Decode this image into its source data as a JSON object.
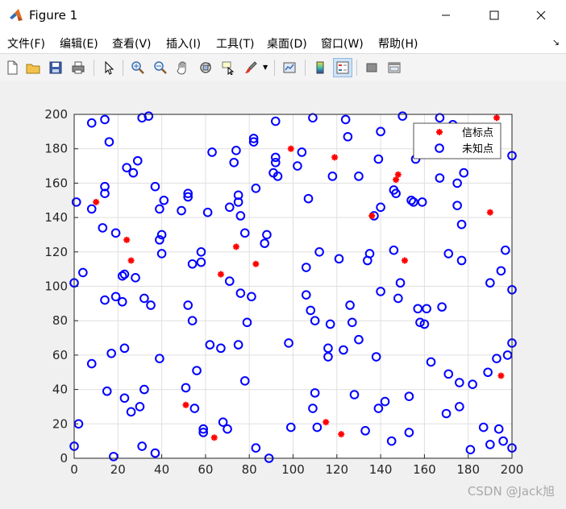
{
  "window": {
    "title": "Figure 1"
  },
  "menu": [
    "文件(F)",
    "编辑(E)",
    "查看(V)",
    "插入(I)",
    "工具(T)",
    "桌面(D)",
    "窗口(W)",
    "帮助(H)"
  ],
  "toolbar": {
    "icons": [
      "new-file-icon",
      "open-file-icon",
      "save-icon",
      "print-icon",
      "pointer-icon",
      "zoom-in-icon",
      "zoom-out-icon",
      "pan-icon",
      "rotate-3d-icon",
      "data-cursor-icon",
      "brush-icon",
      "link-plot-icon",
      "colorbar-icon",
      "legend-icon",
      "hide-plot-tools-icon",
      "show-plot-tools-icon"
    ],
    "active": "legend-icon"
  },
  "chart_data": {
    "type": "scatter",
    "xlim": [
      0,
      200
    ],
    "ylim": [
      0,
      200
    ],
    "xticks": [
      0,
      20,
      40,
      60,
      80,
      100,
      120,
      140,
      160,
      180,
      200
    ],
    "yticks": [
      0,
      20,
      40,
      60,
      80,
      100,
      120,
      140,
      160,
      180,
      200
    ],
    "grid": true,
    "legend_position": "top-right",
    "series": [
      {
        "name": "信标点",
        "marker": "asterisk",
        "color": "#ff0000",
        "points": [
          [
            10,
            149
          ],
          [
            24,
            127
          ],
          [
            26,
            115
          ],
          [
            51,
            31
          ],
          [
            64,
            12
          ],
          [
            67,
            107
          ],
          [
            74,
            123
          ],
          [
            83,
            113
          ],
          [
            99,
            180
          ],
          [
            115,
            21
          ],
          [
            119,
            175
          ],
          [
            122,
            14
          ],
          [
            136,
            141
          ],
          [
            147,
            162
          ],
          [
            148,
            165
          ],
          [
            151,
            115
          ],
          [
            190,
            143
          ],
          [
            193,
            198
          ],
          [
            195,
            48
          ]
        ]
      },
      {
        "name": "未知点",
        "marker": "circle",
        "color": "#0000ff",
        "points": [
          [
            0,
            7
          ],
          [
            1,
            149
          ],
          [
            0,
            102
          ],
          [
            2,
            20
          ],
          [
            4,
            108
          ],
          [
            8,
            145
          ],
          [
            8,
            195
          ],
          [
            8,
            55
          ],
          [
            13,
            134
          ],
          [
            14,
            158
          ],
          [
            14,
            154
          ],
          [
            14,
            197
          ],
          [
            14,
            92
          ],
          [
            15,
            39
          ],
          [
            16,
            184
          ],
          [
            17,
            61
          ],
          [
            18,
            1
          ],
          [
            19,
            131
          ],
          [
            19,
            94
          ],
          [
            22,
            106
          ],
          [
            23,
            107
          ],
          [
            22,
            91
          ],
          [
            23,
            64
          ],
          [
            23,
            35
          ],
          [
            24,
            169
          ],
          [
            26,
            27
          ],
          [
            27,
            166
          ],
          [
            28,
            105
          ],
          [
            29,
            173
          ],
          [
            30,
            30
          ],
          [
            31,
            7
          ],
          [
            31,
            198
          ],
          [
            32,
            93
          ],
          [
            32,
            40
          ],
          [
            34,
            199
          ],
          [
            35,
            89
          ],
          [
            37,
            158
          ],
          [
            37,
            3
          ],
          [
            39,
            127
          ],
          [
            39,
            145
          ],
          [
            40,
            130
          ],
          [
            39,
            58
          ],
          [
            40,
            119
          ],
          [
            41,
            150
          ],
          [
            49,
            144
          ],
          [
            51,
            41
          ],
          [
            52,
            154
          ],
          [
            52,
            152
          ],
          [
            52,
            89
          ],
          [
            54,
            113
          ],
          [
            54,
            80
          ],
          [
            55,
            29
          ],
          [
            56,
            51
          ],
          [
            58,
            114
          ],
          [
            58,
            120
          ],
          [
            59,
            17
          ],
          [
            59,
            15
          ],
          [
            61,
            143
          ],
          [
            62,
            66
          ],
          [
            63,
            178
          ],
          [
            67,
            64
          ],
          [
            68,
            21
          ],
          [
            70,
            17
          ],
          [
            71,
            103
          ],
          [
            71,
            146
          ],
          [
            73,
            172
          ],
          [
            74,
            179
          ],
          [
            75,
            149
          ],
          [
            75,
            153
          ],
          [
            75,
            66
          ],
          [
            76,
            141
          ],
          [
            76,
            96
          ],
          [
            78,
            131
          ],
          [
            78,
            45
          ],
          [
            79,
            79
          ],
          [
            81,
            94
          ],
          [
            82,
            186
          ],
          [
            82,
            184
          ],
          [
            83,
            157
          ],
          [
            83,
            6
          ],
          [
            87,
            125
          ],
          [
            88,
            130
          ],
          [
            89,
            0
          ],
          [
            91,
            166
          ],
          [
            92,
            172
          ],
          [
            92,
            175
          ],
          [
            92,
            196
          ],
          [
            93,
            164
          ],
          [
            98,
            67
          ],
          [
            99,
            18
          ],
          [
            102,
            170
          ],
          [
            104,
            178
          ],
          [
            106,
            95
          ],
          [
            106,
            111
          ],
          [
            107,
            151
          ],
          [
            108,
            86
          ],
          [
            109,
            198
          ],
          [
            109,
            29
          ],
          [
            110,
            80
          ],
          [
            110,
            38
          ],
          [
            111,
            18
          ],
          [
            112,
            120
          ],
          [
            116,
            64
          ],
          [
            116,
            59
          ],
          [
            117,
            78
          ],
          [
            118,
            164
          ],
          [
            121,
            116
          ],
          [
            123,
            63
          ],
          [
            124,
            197
          ],
          [
            125,
            187
          ],
          [
            126,
            89
          ],
          [
            127,
            79
          ],
          [
            128,
            37
          ],
          [
            130,
            164
          ],
          [
            130,
            69
          ],
          [
            133,
            16
          ],
          [
            134,
            115
          ],
          [
            135,
            119
          ],
          [
            137,
            141
          ],
          [
            138,
            59
          ],
          [
            139,
            29
          ],
          [
            139,
            174
          ],
          [
            140,
            190
          ],
          [
            140,
            146
          ],
          [
            140,
            97
          ],
          [
            142,
            33
          ],
          [
            145,
            10
          ],
          [
            146,
            121
          ],
          [
            146,
            156
          ],
          [
            147,
            154
          ],
          [
            148,
            93
          ],
          [
            149,
            102
          ],
          [
            150,
            199
          ],
          [
            153,
            36
          ],
          [
            153,
            15
          ],
          [
            154,
            150
          ],
          [
            155,
            149
          ],
          [
            156,
            174
          ],
          [
            157,
            87
          ],
          [
            158,
            79
          ],
          [
            159,
            149
          ],
          [
            160,
            78
          ],
          [
            161,
            87
          ],
          [
            163,
            56
          ],
          [
            167,
            198
          ],
          [
            167,
            163
          ],
          [
            168,
            88
          ],
          [
            170,
            26
          ],
          [
            171,
            49
          ],
          [
            171,
            119
          ],
          [
            173,
            194
          ],
          [
            175,
            160
          ],
          [
            175,
            147
          ],
          [
            176,
            30
          ],
          [
            176,
            44
          ],
          [
            177,
            115
          ],
          [
            177,
            136
          ],
          [
            178,
            166
          ],
          [
            181,
            5
          ],
          [
            182,
            43
          ],
          [
            187,
            18
          ],
          [
            189,
            50
          ],
          [
            190,
            8
          ],
          [
            190,
            102
          ],
          [
            193,
            58
          ],
          [
            194,
            17
          ],
          [
            195,
            109
          ],
          [
            196,
            10
          ],
          [
            197,
            121
          ],
          [
            198,
            60
          ],
          [
            200,
            176
          ],
          [
            200,
            6
          ],
          [
            200,
            98
          ],
          [
            200,
            67
          ]
        ]
      }
    ]
  },
  "watermark": "CSDN @Jack旭"
}
